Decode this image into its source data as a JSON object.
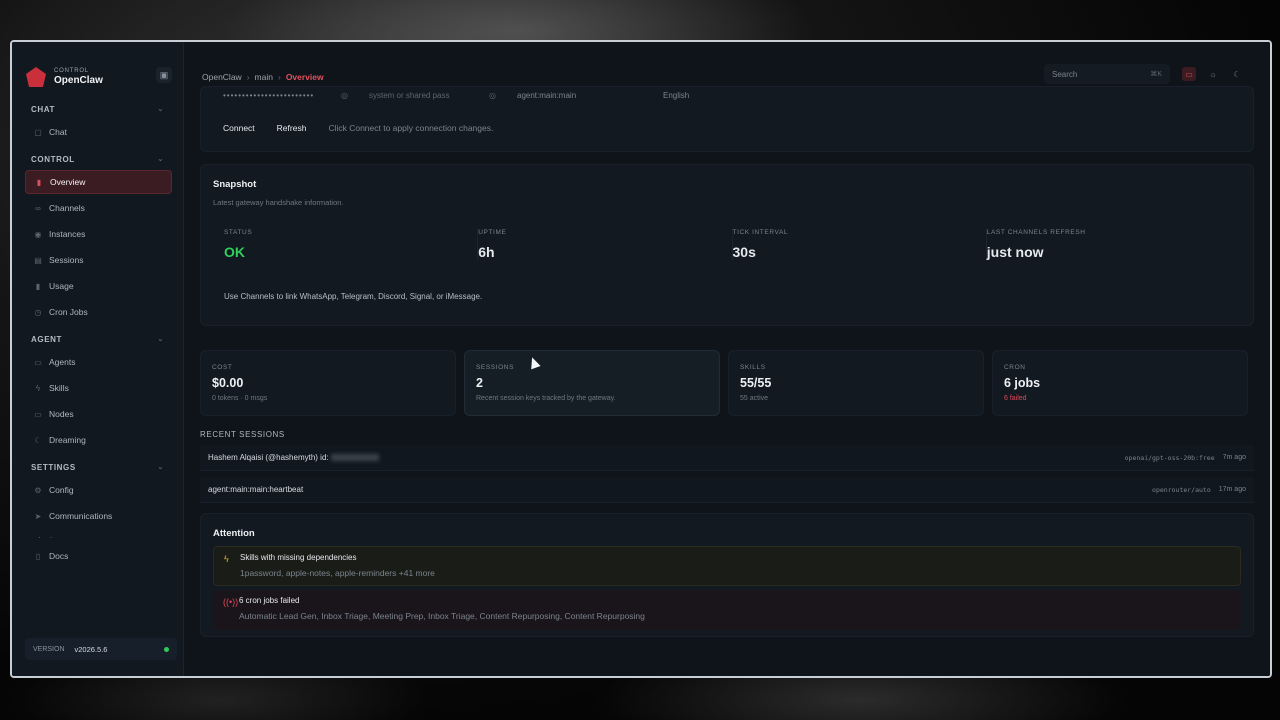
{
  "brand": {
    "sub": "CONTROL",
    "name": "OpenClaw"
  },
  "sidebar": {
    "groups": [
      {
        "title": "CHAT",
        "items": [
          {
            "label": "Chat",
            "icon": "chat-icon"
          }
        ]
      },
      {
        "title": "CONTROL",
        "items": [
          {
            "label": "Overview",
            "icon": "bar-chart-icon",
            "active": true
          },
          {
            "label": "Channels",
            "icon": "link-icon"
          },
          {
            "label": "Instances",
            "icon": "radio-icon"
          },
          {
            "label": "Sessions",
            "icon": "document-icon"
          },
          {
            "label": "Usage",
            "icon": "bar-chart-icon"
          },
          {
            "label": "Cron Jobs",
            "icon": "clock-icon"
          }
        ]
      },
      {
        "title": "AGENT",
        "items": [
          {
            "label": "Agents",
            "icon": "folder-icon"
          },
          {
            "label": "Skills",
            "icon": "lightning-icon"
          },
          {
            "label": "Nodes",
            "icon": "monitor-icon"
          },
          {
            "label": "Dreaming",
            "icon": "moon-icon"
          }
        ]
      },
      {
        "title": "SETTINGS",
        "items": [
          {
            "label": "Config",
            "icon": "gear-icon"
          },
          {
            "label": "Communications",
            "icon": "send-icon"
          }
        ]
      }
    ],
    "docs_label": "Docs",
    "version_label": "VERSION",
    "version_value": "v2026.5.6"
  },
  "breadcrumb": {
    "root": "OpenClaw",
    "middle": "main",
    "current": "Overview"
  },
  "search": {
    "placeholder": "Search",
    "shortcut": "⌘K"
  },
  "connection": {
    "password_mask": "••••••••••••••••••••••••",
    "password_placeholder": "system or shared pass",
    "session_key": "agent:main:main",
    "language": "English",
    "connect_label": "Connect",
    "refresh_label": "Refresh",
    "hint": "Click Connect to apply connection changes."
  },
  "snapshot": {
    "title": "Snapshot",
    "subtitle": "Latest gateway handshake information.",
    "stats": [
      {
        "label": "STATUS",
        "value": "OK"
      },
      {
        "label": "UPTIME",
        "value": "6h"
      },
      {
        "label": "TICK INTERVAL",
        "value": "30s"
      },
      {
        "label": "LAST CHANNELS REFRESH",
        "value": "just now"
      }
    ],
    "note": "Use Channels to link WhatsApp, Telegram, Discord, Signal, or iMessage."
  },
  "metrics": [
    {
      "label": "COST",
      "value": "$0.00",
      "sub": "0 tokens · 0 msgs"
    },
    {
      "label": "SESSIONS",
      "value": "2",
      "sub": "Recent session keys tracked by the gateway."
    },
    {
      "label": "SKILLS",
      "value": "55/55",
      "sub": "55 active"
    },
    {
      "label": "CRON",
      "value": "6 jobs",
      "sub": "6 failed"
    }
  ],
  "recent_sessions": {
    "title": "RECENT SESSIONS",
    "rows": [
      {
        "name": "Hashem Alqaisi (@hashemyth) id:",
        "model": "openai/gpt-oss-20b:free",
        "age": "7m ago"
      },
      {
        "name": "agent:main:main:heartbeat",
        "model": "openrouter/auto",
        "age": "17m ago"
      }
    ]
  },
  "attention": {
    "title": "Attention",
    "alerts": [
      {
        "title": "Skills with missing dependencies",
        "desc": "1password, apple-notes, apple-reminders +41 more"
      },
      {
        "title": "6 cron jobs failed",
        "desc": "Automatic Lead Gen, Inbox Triage, Meeting Prep, Inbox Triage, Content Repurposing, Content Repurposing"
      }
    ]
  },
  "colors": {
    "accent": "#e4505d",
    "ok": "#2fd05a",
    "warn": "#e0b33a",
    "danger": "#e0485a"
  }
}
